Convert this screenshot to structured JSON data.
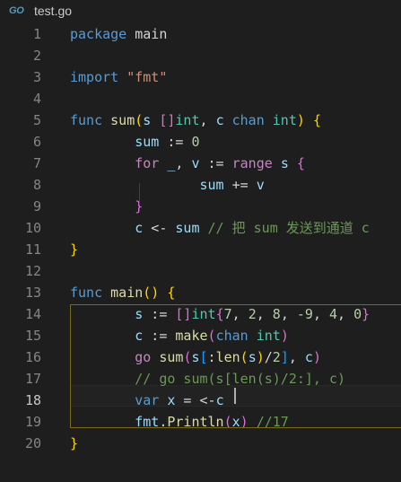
{
  "tab": {
    "icon": "GO",
    "title": "test.go"
  },
  "editor": {
    "active_line": 18,
    "lines": [
      {
        "n": "1",
        "tokens": [
          [
            "kw",
            "package"
          ],
          [
            "plain",
            " main"
          ]
        ]
      },
      {
        "n": "2",
        "tokens": []
      },
      {
        "n": "3",
        "tokens": [
          [
            "kw",
            "import"
          ],
          [
            "plain",
            " "
          ],
          [
            "str",
            "\"fmt\""
          ]
        ]
      },
      {
        "n": "4",
        "tokens": []
      },
      {
        "n": "5",
        "tokens": [
          [
            "kw",
            "func"
          ],
          [
            "plain",
            " "
          ],
          [
            "fn",
            "sum"
          ],
          [
            "br1",
            "("
          ],
          [
            "var",
            "s"
          ],
          [
            "plain",
            " "
          ],
          [
            "br2",
            "[]"
          ],
          [
            "ty",
            "int"
          ],
          [
            "plain",
            ", "
          ],
          [
            "var",
            "c"
          ],
          [
            "plain",
            " "
          ],
          [
            "kw",
            "chan"
          ],
          [
            "plain",
            " "
          ],
          [
            "ty",
            "int"
          ],
          [
            "br1",
            ")"
          ],
          [
            "plain",
            " "
          ],
          [
            "br1",
            "{"
          ]
        ]
      },
      {
        "n": "6",
        "tokens": [
          [
            "plain",
            "        "
          ],
          [
            "var",
            "sum"
          ],
          [
            "plain",
            " := "
          ],
          [
            "num",
            "0"
          ]
        ]
      },
      {
        "n": "7",
        "tokens": [
          [
            "plain",
            "        "
          ],
          [
            "ctl",
            "for"
          ],
          [
            "plain",
            " "
          ],
          [
            "var",
            "_"
          ],
          [
            "plain",
            ", "
          ],
          [
            "var",
            "v"
          ],
          [
            "plain",
            " := "
          ],
          [
            "ctl",
            "range"
          ],
          [
            "plain",
            " "
          ],
          [
            "var",
            "s"
          ],
          [
            "plain",
            " "
          ],
          [
            "br2",
            "{"
          ]
        ]
      },
      {
        "n": "8",
        "tokens": [
          [
            "plain",
            "                "
          ],
          [
            "var",
            "sum"
          ],
          [
            "plain",
            " += "
          ],
          [
            "var",
            "v"
          ]
        ]
      },
      {
        "n": "9",
        "tokens": [
          [
            "plain",
            "        "
          ],
          [
            "br2",
            "}"
          ]
        ]
      },
      {
        "n": "10",
        "tokens": [
          [
            "plain",
            "        "
          ],
          [
            "var",
            "c"
          ],
          [
            "plain",
            " <- "
          ],
          [
            "var",
            "sum"
          ],
          [
            "plain",
            " "
          ],
          [
            "cmt",
            "// 把 sum 发送到通道 c"
          ]
        ]
      },
      {
        "n": "11",
        "tokens": [
          [
            "br1",
            "}"
          ]
        ]
      },
      {
        "n": "12",
        "tokens": []
      },
      {
        "n": "13",
        "tokens": [
          [
            "kw",
            "func"
          ],
          [
            "plain",
            " "
          ],
          [
            "fn",
            "main"
          ],
          [
            "br1",
            "()"
          ],
          [
            "plain",
            " "
          ],
          [
            "br1",
            "{"
          ]
        ]
      },
      {
        "n": "14",
        "tokens": [
          [
            "plain",
            "        "
          ],
          [
            "var",
            "s"
          ],
          [
            "plain",
            " := "
          ],
          [
            "br2",
            "[]"
          ],
          [
            "ty",
            "int"
          ],
          [
            "br2",
            "{"
          ],
          [
            "num",
            "7"
          ],
          [
            "plain",
            ", "
          ],
          [
            "num",
            "2"
          ],
          [
            "plain",
            ", "
          ],
          [
            "num",
            "8"
          ],
          [
            "plain",
            ", "
          ],
          [
            "num",
            "-9"
          ],
          [
            "plain",
            ", "
          ],
          [
            "num",
            "4"
          ],
          [
            "plain",
            ", "
          ],
          [
            "num",
            "0"
          ],
          [
            "br2",
            "}"
          ]
        ]
      },
      {
        "n": "15",
        "tokens": [
          [
            "plain",
            "        "
          ],
          [
            "var",
            "c"
          ],
          [
            "plain",
            " := "
          ],
          [
            "fn",
            "make"
          ],
          [
            "br2",
            "("
          ],
          [
            "kw",
            "chan"
          ],
          [
            "plain",
            " "
          ],
          [
            "ty",
            "int"
          ],
          [
            "br2",
            ")"
          ]
        ]
      },
      {
        "n": "16",
        "tokens": [
          [
            "plain",
            "        "
          ],
          [
            "ctl",
            "go"
          ],
          [
            "plain",
            " "
          ],
          [
            "fn",
            "sum"
          ],
          [
            "br2",
            "("
          ],
          [
            "var",
            "s"
          ],
          [
            "br3",
            "["
          ],
          [
            "plain",
            ":"
          ],
          [
            "fn",
            "len"
          ],
          [
            "br1",
            "("
          ],
          [
            "var",
            "s"
          ],
          [
            "br1",
            ")"
          ],
          [
            "plain",
            "/"
          ],
          [
            "num",
            "2"
          ],
          [
            "br3",
            "]"
          ],
          [
            "plain",
            ", "
          ],
          [
            "var",
            "c"
          ],
          [
            "br2",
            ")"
          ]
        ]
      },
      {
        "n": "17",
        "tokens": [
          [
            "plain",
            "        "
          ],
          [
            "cmt",
            "// go sum(s[len(s)/2:], c)"
          ]
        ]
      },
      {
        "n": "18",
        "tokens": [
          [
            "plain",
            "        "
          ],
          [
            "kw",
            "var"
          ],
          [
            "plain",
            " "
          ],
          [
            "var",
            "x"
          ],
          [
            "plain",
            " = <-"
          ],
          [
            "var",
            "c"
          ]
        ]
      },
      {
        "n": "19",
        "tokens": [
          [
            "plain",
            "        "
          ],
          [
            "var",
            "fmt"
          ],
          [
            "plain",
            "."
          ],
          [
            "fn",
            "Println"
          ],
          [
            "br2",
            "("
          ],
          [
            "var",
            "x"
          ],
          [
            "br2",
            ")"
          ],
          [
            "plain",
            " "
          ],
          [
            "cmt",
            "//17"
          ]
        ]
      },
      {
        "n": "20",
        "tokens": [
          [
            "br1",
            "}"
          ]
        ]
      }
    ]
  }
}
